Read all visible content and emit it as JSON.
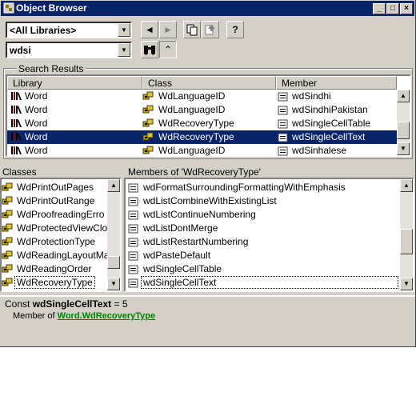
{
  "window": {
    "title": "Object Browser",
    "min_glyph": "_",
    "max_glyph": "□",
    "close_glyph": "×"
  },
  "toolbar": {
    "library_combo": "<All Libraries>",
    "search_combo": "wdsi",
    "back_glyph": "◄",
    "forward_glyph": "►",
    "help_glyph": "?",
    "toggle_glyph": "⌃"
  },
  "search_results": {
    "label": "Search Results",
    "columns": [
      "Library",
      "Class",
      "Member"
    ],
    "rows": [
      {
        "library": "Word",
        "class": "WdLanguageID",
        "member": "wdSindhi",
        "selected": false
      },
      {
        "library": "Word",
        "class": "WdLanguageID",
        "member": "wdSindhiPakistan",
        "selected": false
      },
      {
        "library": "Word",
        "class": "WdRecoveryType",
        "member": "wdSingleCellTable",
        "selected": false
      },
      {
        "library": "Word",
        "class": "WdRecoveryType",
        "member": "wdSingleCellText",
        "selected": true
      },
      {
        "library": "Word",
        "class": "WdLanguageID",
        "member": "wdSinhalese",
        "selected": false
      }
    ]
  },
  "classes": {
    "header": "Classes",
    "items": [
      "WdPrintOutPages",
      "WdPrintOutRange",
      "WdProofreadingErro",
      "WdProtectedViewClo",
      "WdProtectionType",
      "WdReadingLayoutMa",
      "WdReadingOrder",
      "WdRecoveryType"
    ],
    "selected_index": 7
  },
  "members": {
    "header": "Members of 'WdRecoveryType'",
    "items": [
      "wdFormatSurroundingFormattingWithEmphasis",
      "wdListCombineWithExistingList",
      "wdListContinueNumbering",
      "wdListDontMerge",
      "wdListRestartNumbering",
      "wdPasteDefault",
      "wdSingleCellTable",
      "wdSingleCellText"
    ],
    "selected_index": 7
  },
  "details": {
    "prefix": "Const ",
    "name": "wdSingleCellText",
    "value_text": " = 5",
    "member_of": "Member of ",
    "library_link": "Word",
    "dot": ".",
    "class_link": "WdRecoveryType"
  },
  "colors": {
    "selection": "#0a246a",
    "link": "#008000",
    "face": "#d4d0c8"
  }
}
